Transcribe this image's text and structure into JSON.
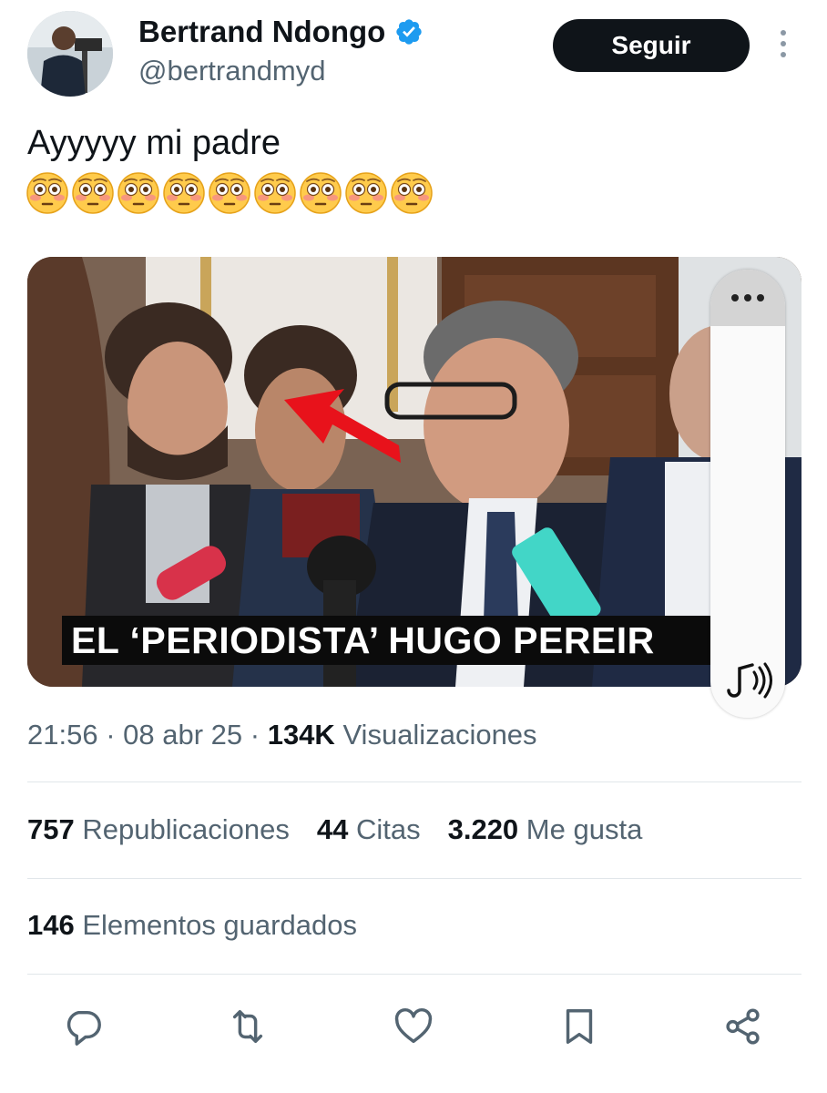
{
  "user": {
    "display_name": "Bertrand Ndongo",
    "handle": "@bertrandmyd",
    "verified_icon": "verified-badge-icon"
  },
  "follow_label": "Seguir",
  "tweet": {
    "text": "Ayyyyy mi padre",
    "emoji": "😳😳😳😳😳😳😳😳😳",
    "emoji_count": 9
  },
  "media": {
    "caption": "EL ‘PERIODISTA’ HUGO PEREIR",
    "type": "video"
  },
  "meta": {
    "time": "21:56",
    "date": "08 abr 25",
    "views_count": "134K",
    "views_label": "Visualizaciones"
  },
  "stats": {
    "reposts_count": "757",
    "reposts_label": "Republicaciones",
    "quotes_count": "44",
    "quotes_label": "Citas",
    "likes_count": "3.220",
    "likes_label": "Me gusta"
  },
  "saved": {
    "count": "146",
    "label": "Elementos guardados"
  },
  "colors": {
    "verified": "#1d9bf0",
    "button_bg": "#0f1419",
    "secondary_text": "#536471",
    "arrow": "#e8121b"
  }
}
